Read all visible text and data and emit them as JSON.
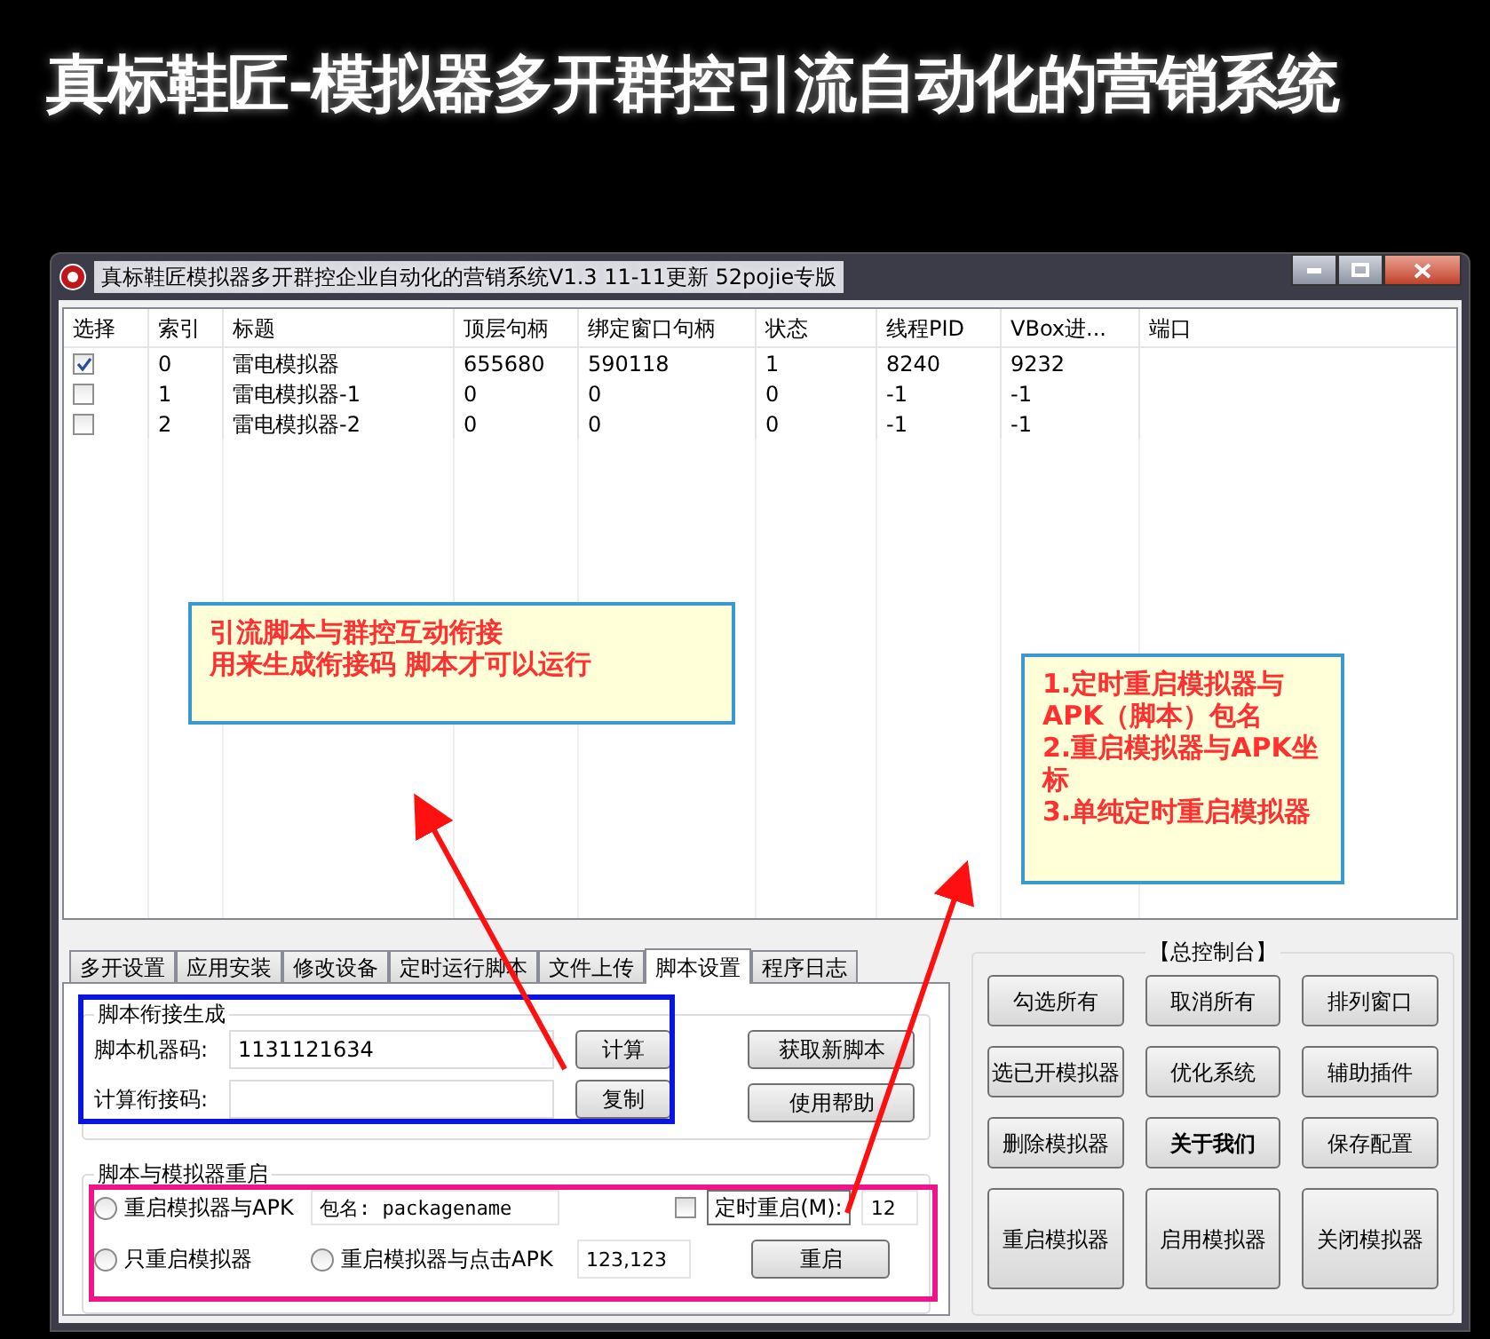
{
  "banner": {
    "title": "真标鞋匠-模拟器多开群控引流自动化的营销系统"
  },
  "window": {
    "title": "真标鞋匠模拟器多开群控企业自动化的营销系统V1.3 11-11更新 52pojie专版"
  },
  "table": {
    "columns": [
      "选择",
      "索引",
      "标题",
      "顶层句柄",
      "绑定窗口句柄",
      "状态",
      "线程PID",
      "VBox进...",
      "端口"
    ],
    "rows": [
      {
        "checked": true,
        "cells": [
          "",
          "0",
          "雷电模拟器",
          "655680",
          "590118",
          "1",
          "8240",
          "9232"
        ]
      },
      {
        "checked": false,
        "cells": [
          "",
          "1",
          "雷电模拟器-1",
          "0",
          "0",
          "0",
          "-1",
          "-1"
        ]
      },
      {
        "checked": false,
        "cells": [
          "",
          "2",
          "雷电模拟器-2",
          "0",
          "0",
          "0",
          "-1",
          "-1"
        ]
      }
    ]
  },
  "callouts": [
    {
      "lines": [
        "引流脚本与群控互动衔接",
        "用来生成衔接码 脚本才可以运行"
      ]
    },
    {
      "lines": [
        "1.定时重启模拟器与APK（脚本）包名",
        "2.重启模拟器与APK坐标",
        "3.单纯定时重启模拟器"
      ]
    }
  ],
  "tabs": [
    {
      "label": "多开设置",
      "selected": false
    },
    {
      "label": "应用安装",
      "selected": false
    },
    {
      "label": "修改设备",
      "selected": false
    },
    {
      "label": "定时运行脚本",
      "selected": false
    },
    {
      "label": "文件上传",
      "selected": false
    },
    {
      "label": "脚本设置",
      "selected": true
    },
    {
      "label": "程序日志",
      "selected": false
    }
  ],
  "script_link": {
    "title": "脚本衔接生成",
    "machine_code": {
      "label": "脚本机器码:",
      "value": "1131121634"
    },
    "link_code": {
      "label": "计算衔接码:"
    },
    "calc_button": "计算",
    "copy_button": "复制",
    "side_buttons": [
      "获取新脚本",
      "使用帮助"
    ]
  },
  "restart": {
    "title": "脚本与模拟器重启",
    "options": [
      {
        "label": "重启模拟器与APK",
        "selected": false
      },
      {
        "label": "只重启模拟器",
        "selected": false
      },
      {
        "label": "重启模拟器与点击APK",
        "selected": false
      }
    ],
    "package_field": "包名: packagename",
    "coord_field": "123,123",
    "timer": {
      "checked": false,
      "label": "定时重启(M):",
      "value": "12"
    },
    "restart_button": "重启"
  },
  "console": {
    "title": "【总控制台】",
    "buttons": [
      {
        "label": "勾选所有",
        "bold": false
      },
      {
        "label": "取消所有",
        "bold": false
      },
      {
        "label": "排列窗口",
        "bold": false
      },
      {
        "label": "选已开模拟器",
        "bold": false
      },
      {
        "label": "优化系统",
        "bold": false
      },
      {
        "label": "辅助插件",
        "bold": false
      },
      {
        "label": "删除模拟器",
        "bold": false
      },
      {
        "label": "关于我们",
        "bold": true
      },
      {
        "label": "保存配置",
        "bold": false
      },
      {
        "label": "重启模拟器",
        "bold": false
      },
      {
        "label": "启用模拟器",
        "bold": false
      },
      {
        "label": "关闭模拟器",
        "bold": false
      }
    ]
  }
}
